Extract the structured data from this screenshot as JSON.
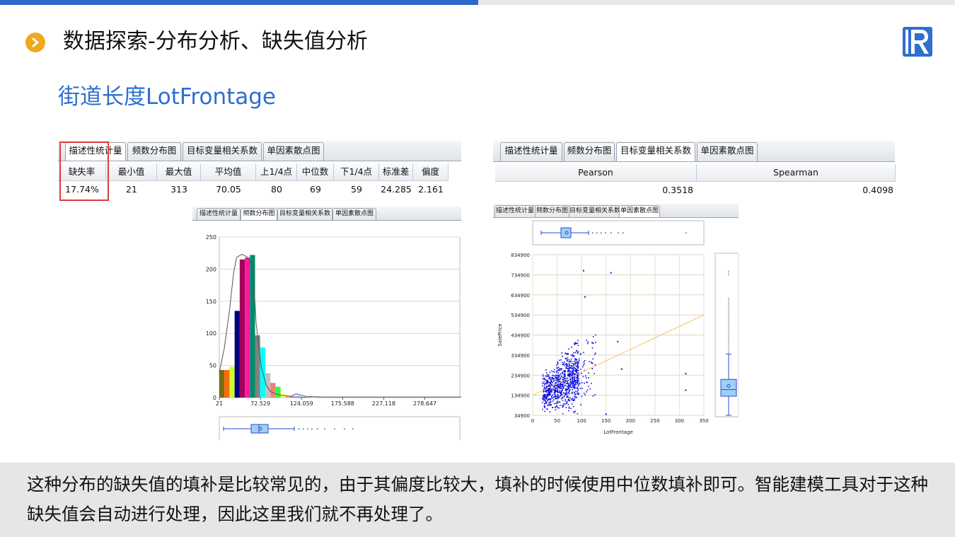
{
  "header": {
    "title": "数据探索-分布分析、缺失值分析",
    "subtitle": "街道长度LotFrontage"
  },
  "tabs": [
    "描述性统计量",
    "频数分布图",
    "目标变量相关系数",
    "单因素散点图"
  ],
  "stats_table": {
    "headers": [
      "缺失率",
      "最小值",
      "最大值",
      "平均值",
      "上1/4点",
      "中位数",
      "下1/4点",
      "标准差",
      "偏度"
    ],
    "values": [
      "17.74%",
      "21",
      "313",
      "70.05",
      "80",
      "69",
      "59",
      "24.285",
      "2.161"
    ]
  },
  "corr_table": {
    "headers": [
      "Pearson",
      "Spearman"
    ],
    "values": [
      "0.3518",
      "0.4098"
    ]
  },
  "histogram": {
    "y_ticks": [
      "0",
      "50",
      "100",
      "150",
      "200",
      "250"
    ],
    "x_ticks": [
      "21",
      "72.529",
      "124.059",
      "175.588",
      "227.118",
      "278.647"
    ]
  },
  "scatter": {
    "ylabel": "SalePrice",
    "xlabel": "LotFrontage",
    "y_ticks": [
      "34900",
      "134900",
      "234900",
      "334900",
      "434900",
      "534900",
      "634900",
      "734900",
      "834900"
    ],
    "x_ticks": [
      "0",
      "50",
      "100",
      "150",
      "200",
      "250",
      "300",
      "350"
    ]
  },
  "chart_data": [
    {
      "type": "bar",
      "x": [
        21,
        72.529,
        124.059,
        175.588,
        227.118,
        278.647
      ],
      "bars": [
        {
          "x": 21,
          "value": 43,
          "color": "#7a6a14"
        },
        {
          "x": 23,
          "value": 43,
          "color": "#ff6a00"
        },
        {
          "x": 25,
          "value": 48,
          "color": "#ccff33"
        },
        {
          "x": 27,
          "value": 135,
          "color": "#000080"
        },
        {
          "x": 29,
          "value": 215,
          "color": "#a0005a"
        },
        {
          "x": 31,
          "value": 218,
          "color": "#ff1a9c"
        },
        {
          "x": 33,
          "value": 222,
          "color": "#008b6b"
        },
        {
          "x": 35,
          "value": 97,
          "color": "#808080"
        },
        {
          "x": 37,
          "value": 78,
          "color": "#00ffff"
        },
        {
          "x": 39,
          "value": 38,
          "color": "#c0c0c0"
        },
        {
          "x": 41,
          "value": 23,
          "color": "#f08080"
        },
        {
          "x": 43,
          "value": 17,
          "color": "#33ff33"
        },
        {
          "x": 45,
          "value": 6,
          "color": "#ffff55"
        },
        {
          "x": 47,
          "value": 3,
          "color": "#ffaa88"
        },
        {
          "x": 49,
          "value": 2,
          "color": "#cc66cc"
        },
        {
          "x": 51,
          "value": 2,
          "color": "#4f9bd9"
        },
        {
          "x": 53,
          "value": 1,
          "color": "#c000c0"
        },
        {
          "x": 55,
          "value": 1,
          "color": "#55aaff"
        }
      ],
      "ylim": [
        0,
        250
      ]
    },
    {
      "type": "scatter",
      "xlim": [
        0,
        350
      ],
      "ylim": [
        34900,
        834900
      ],
      "trend": {
        "x": [
          0,
          350
        ],
        "y": [
          134900,
          534900
        ]
      },
      "outliers": [
        {
          "x": 104,
          "y": 755000
        },
        {
          "x": 160,
          "y": 745000
        },
        {
          "x": 313,
          "y": 242000
        },
        {
          "x": 313,
          "y": 160000
        },
        {
          "x": 107,
          "y": 625000
        },
        {
          "x": 174,
          "y": 402000
        },
        {
          "x": 182,
          "y": 265000
        },
        {
          "x": 150,
          "y": 40000
        }
      ]
    }
  ],
  "footer": {
    "text": "这种分布的缺失值的填补是比较常见的，由于其偏度比较大，填补的时候使用中位数填补即可。智能建模工具对于这种缺失值会自动进行处理，因此这里我们就不再处理了。"
  }
}
